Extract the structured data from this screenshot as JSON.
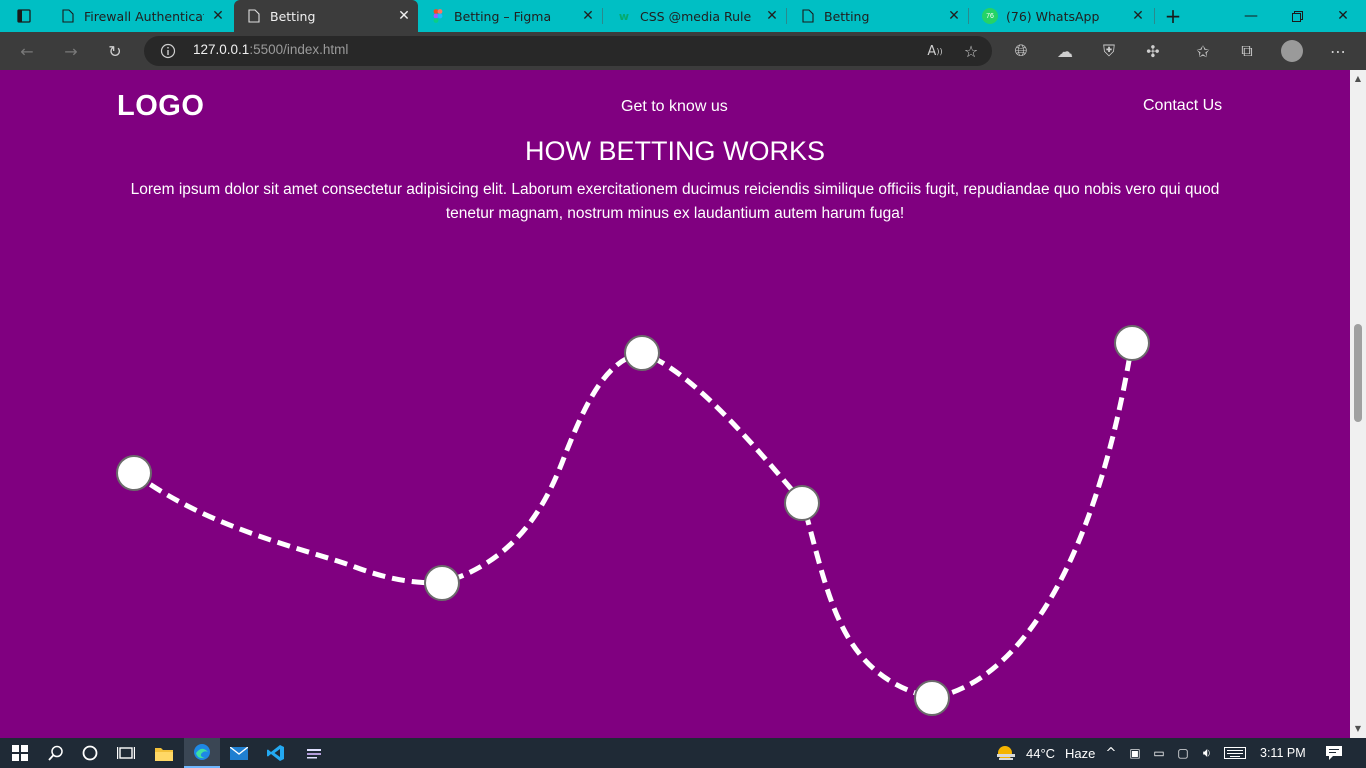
{
  "browser": {
    "tabs": [
      {
        "title": "Firewall Authentication",
        "icon": "document-icon",
        "active": false
      },
      {
        "title": "Betting",
        "icon": "document-icon",
        "active": true
      },
      {
        "title": "Betting – Figma",
        "icon": "figma-icon",
        "active": false
      },
      {
        "title": "CSS @media Rule",
        "icon": "w3schools-icon",
        "active": false
      },
      {
        "title": "Betting",
        "icon": "document-icon",
        "active": false
      },
      {
        "title": "(76) WhatsApp",
        "icon": "whatsapp-icon",
        "active": false
      }
    ],
    "whatsapp_badge": "76",
    "address": {
      "host": "127.0.0.1",
      "path": ":5500/index.html"
    },
    "colors": {
      "tabstrip": "#00bfc4",
      "toolbar": "#3c3c3c",
      "page_bg": "#800080"
    }
  },
  "page": {
    "logo": "LOGO",
    "nav": {
      "link1": "Get to know us",
      "link2": "Contact Us"
    },
    "heading": "HOW BETTING WORKS",
    "paragraph": "Lorem ipsum dolor sit amet consectetur adipisicing elit. Laborum exercitationem ducimus reiciendis similique officiis fugit, repudiandae quo nobis vero qui quod tenetur magnam, nostrum minus ex laudantium autem harum fuga!"
  },
  "taskbar": {
    "weather": {
      "temp": "44°C",
      "condition": "Haze"
    },
    "time": "3:11 PM"
  }
}
